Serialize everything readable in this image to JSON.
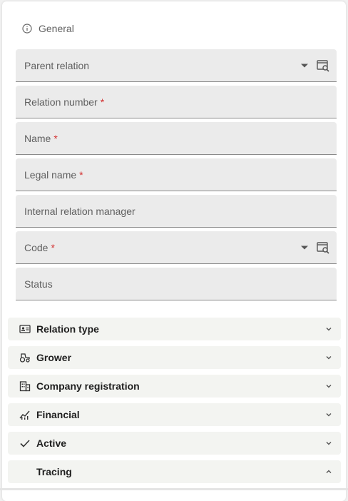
{
  "section": {
    "title": "General",
    "icon": "info-icon"
  },
  "fields": [
    {
      "label": "Parent relation",
      "required": "",
      "has_dropdown": true
    },
    {
      "label": "Relation number",
      "required": "*",
      "has_dropdown": false
    },
    {
      "label": "Name",
      "required": "*",
      "has_dropdown": false
    },
    {
      "label": "Legal name",
      "required": "*",
      "has_dropdown": false
    },
    {
      "label": "Internal relation manager",
      "required": "",
      "has_dropdown": false
    },
    {
      "label": "Code",
      "required": "*",
      "has_dropdown": true
    },
    {
      "label": "Status",
      "required": "",
      "has_dropdown": false
    }
  ],
  "accordions": [
    {
      "title": "Relation type",
      "icon": "id-card-icon",
      "expanded": false
    },
    {
      "title": "Grower",
      "icon": "tractor-icon",
      "expanded": false
    },
    {
      "title": "Company registration",
      "icon": "building-icon",
      "expanded": false
    },
    {
      "title": "Financial",
      "icon": "chart-icon",
      "expanded": false
    },
    {
      "title": "Active",
      "icon": "check-icon",
      "expanded": false
    },
    {
      "title": "Tracing",
      "icon": "",
      "expanded": true
    }
  ],
  "colors": {
    "required": "#d32f2f",
    "field_bg": "#ebebeb",
    "accordion_bg": "#f3f4f1"
  }
}
